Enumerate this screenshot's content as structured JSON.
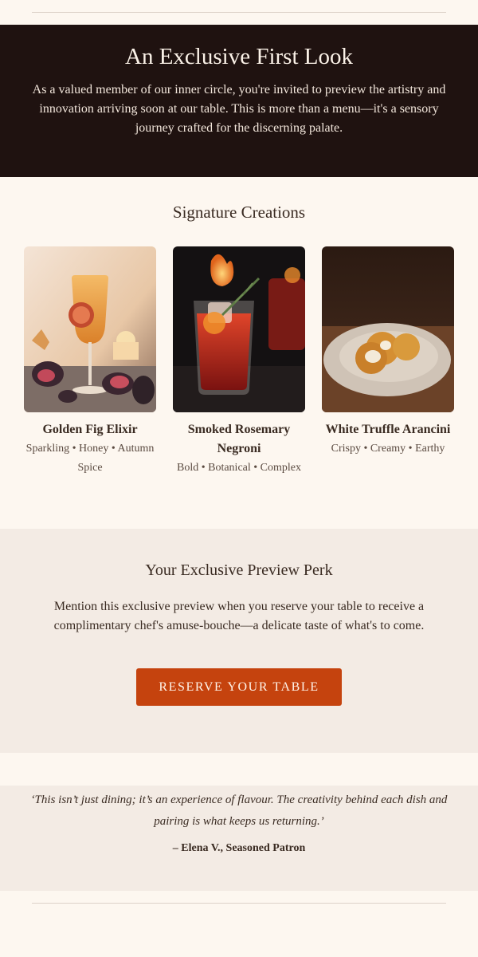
{
  "hero": {
    "title": "An Exclusive First Look",
    "body": "As a valued member of our inner circle, you're invited to preview the artistry and innovation arriving soon at our table. This is more than a menu—it's a sensory journey crafted for the discerning palate."
  },
  "creations": {
    "heading": "Signature Creations",
    "items": [
      {
        "name": "Golden Fig Elixir",
        "notes": "Sparkling • Honey • Autumn Spice",
        "image": "golden-fig-cocktail-photo"
      },
      {
        "name": "Smoked Rosemary Negroni",
        "notes": "Bold • Botanical • Complex",
        "image": "smoked-negroni-photo"
      },
      {
        "name": "White Truffle Arancini",
        "notes": "Crispy • Creamy • Earthy",
        "image": "truffle-arancini-photo"
      }
    ]
  },
  "perk": {
    "heading": "Your Exclusive Preview Perk",
    "body": "Mention this exclusive preview when you reserve your table to receive a complimentary chef's amuse-bouche—a delicate taste of what's to come.",
    "button_label": "RESERVE YOUR TABLE"
  },
  "testimonial": {
    "quote": "‘This isn’t just dining; it’s an experience of flavour. The creativity behind each dish and pairing is what keeps us returning.’",
    "author": "– Elena V., Seasoned Patron"
  },
  "colors": {
    "background": "#fdf7f0",
    "hero_bg": "#1f1210",
    "section_alt_bg": "#f3ebe4",
    "accent": "#c5430e"
  }
}
